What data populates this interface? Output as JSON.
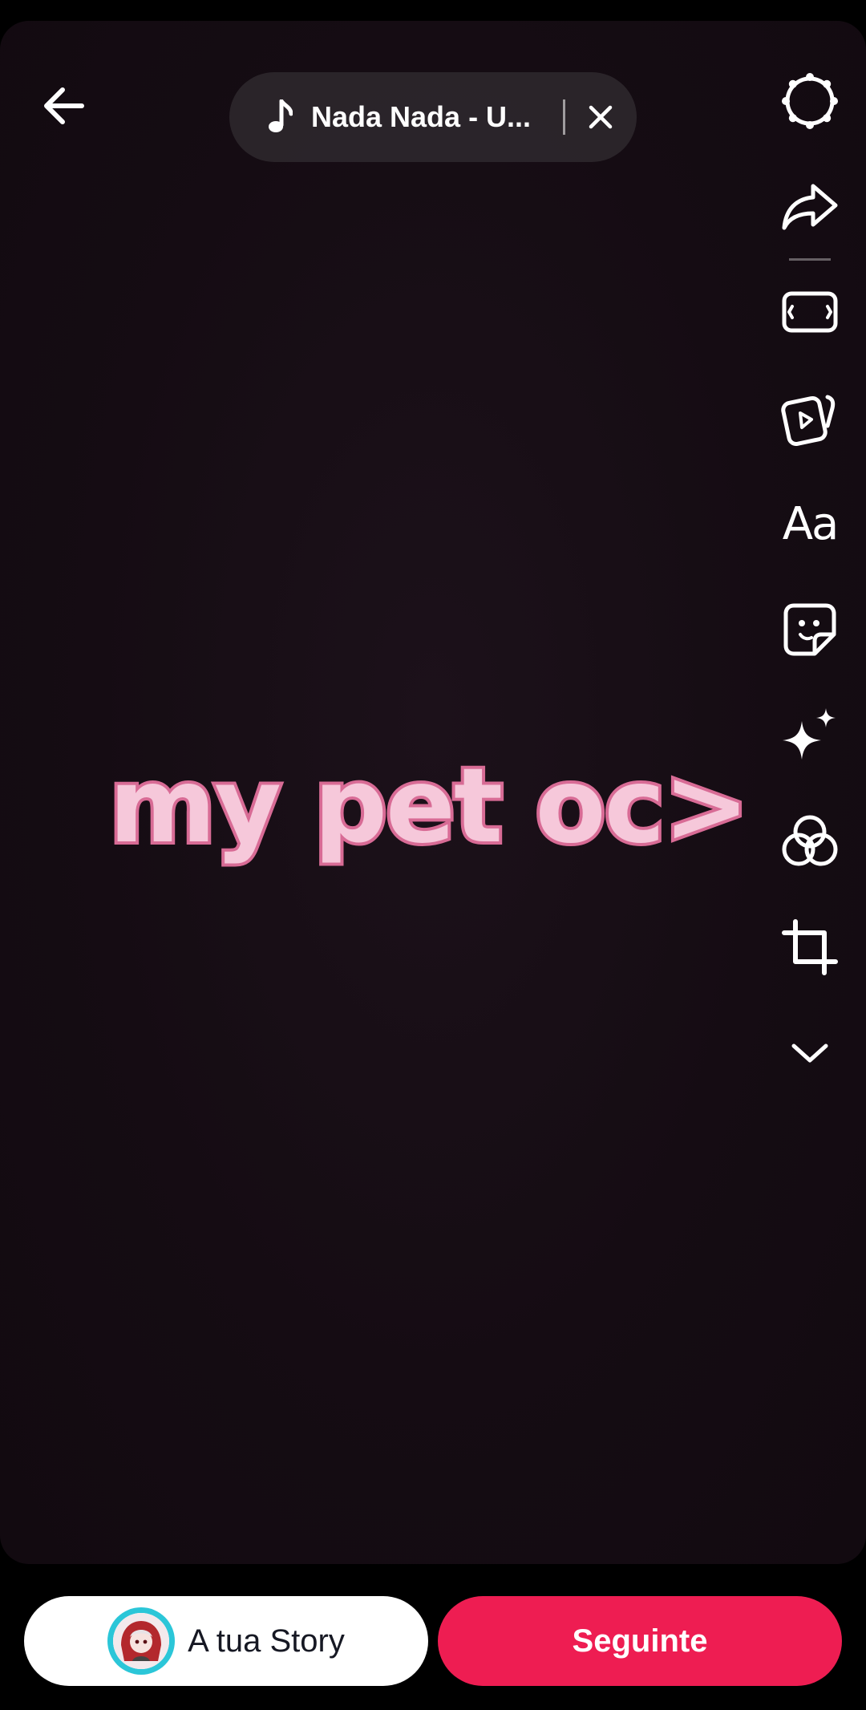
{
  "header": {
    "back_icon": "arrow-left-icon",
    "music": {
      "icon": "music-note-icon",
      "title": "Nada Nada - U...",
      "close_icon": "close-icon"
    }
  },
  "toolbar": {
    "items": [
      {
        "name": "settings",
        "icon": "gear-icon"
      },
      {
        "name": "share",
        "icon": "share-arrow-icon"
      },
      {
        "name": "template",
        "icon": "film-frame-icon"
      },
      {
        "name": "video-cards",
        "icon": "video-cards-icon"
      },
      {
        "name": "text",
        "icon": "text-icon",
        "label": "Aa"
      },
      {
        "name": "stickers",
        "icon": "sticker-icon"
      },
      {
        "name": "effects",
        "icon": "sparkles-icon"
      },
      {
        "name": "filters",
        "icon": "filters-icon"
      },
      {
        "name": "crop",
        "icon": "crop-icon"
      },
      {
        "name": "more",
        "icon": "chevron-down-icon"
      }
    ]
  },
  "canvas": {
    "overlay_text": "my pet oc>",
    "overlay_fill": "#f6c8da",
    "overlay_stroke": "#d86b95"
  },
  "footer": {
    "story_label": "A tua Story",
    "next_label": "Seguinte",
    "next_color": "#ee1d52"
  }
}
